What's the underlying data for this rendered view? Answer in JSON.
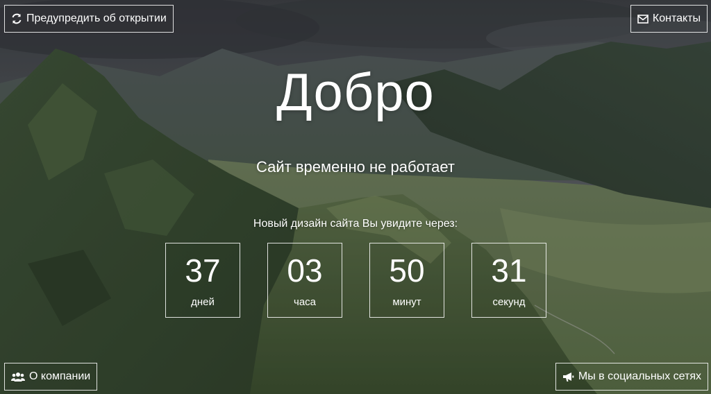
{
  "header": {
    "notify_label": "Предупредить об открытии",
    "contacts_label": "Контакты"
  },
  "hero": {
    "title": "Добро",
    "subtitle": "Сайт временно не работает",
    "countdown_label": "Новый дизайн сайта Вы увидите через:"
  },
  "countdown": [
    {
      "value": "37",
      "unit": "дней"
    },
    {
      "value": "03",
      "unit": "часа"
    },
    {
      "value": "50",
      "unit": "минут"
    },
    {
      "value": "31",
      "unit": "секунд"
    }
  ],
  "footer": {
    "about_label": "О компании",
    "social_label": "Мы в социальных сетях"
  },
  "icons": {
    "notify": "refresh-icon",
    "contacts": "envelope-icon",
    "about": "users-icon",
    "social": "megaphone-icon"
  },
  "colors": {
    "text": "#ffffff",
    "border": "#ffffff",
    "sky": "#4a4e52",
    "mountain": "#3f5a3a"
  }
}
